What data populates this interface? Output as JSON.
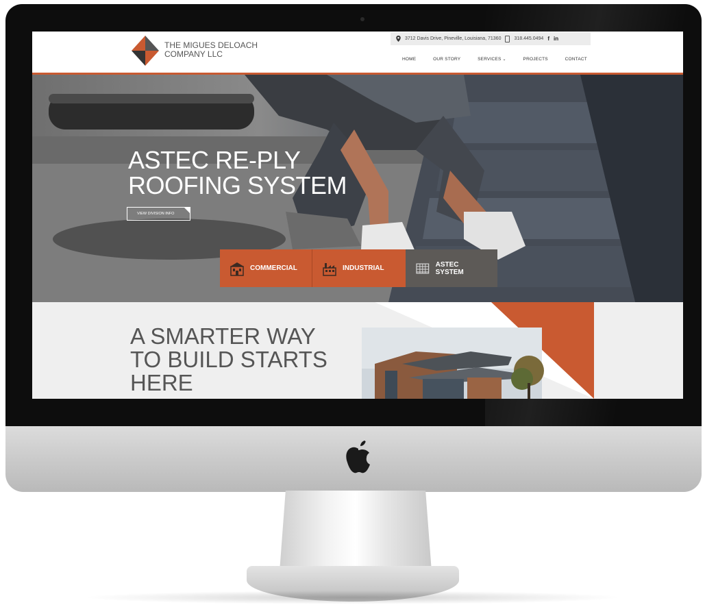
{
  "site": {
    "logo_line1": "THE MIGUES DELOACH",
    "logo_line2": "COMPANY LLC",
    "address": "3712 Davis Drive, Pineville, Louisiana, 71360",
    "phone": "318.445.0494",
    "social_fb": "f",
    "social_in": "in"
  },
  "nav": {
    "items": [
      "HOME",
      "OUR STORY",
      "SERVICES",
      "PROJECTS",
      "CONTACT"
    ]
  },
  "hero": {
    "title_line1": "ASTEC RE-PLY",
    "title_line2": "ROOFING SYSTEM",
    "button_label": "VIEW DIVISION INFO"
  },
  "divisions": {
    "items": [
      "COMMERCIAL",
      "INDUSTRIAL",
      "ASTEC SYSTEM"
    ]
  },
  "intro": {
    "line1": "A SMARTER WAY",
    "line2": "TO BUILD STARTS",
    "line3": "HERE"
  },
  "colors": {
    "accent": "#c95a31",
    "dark_tab": "#5d5a57"
  },
  "icons": {
    "apple": "apple-icon",
    "pin": "location-pin-icon",
    "phone": "phone-icon"
  }
}
